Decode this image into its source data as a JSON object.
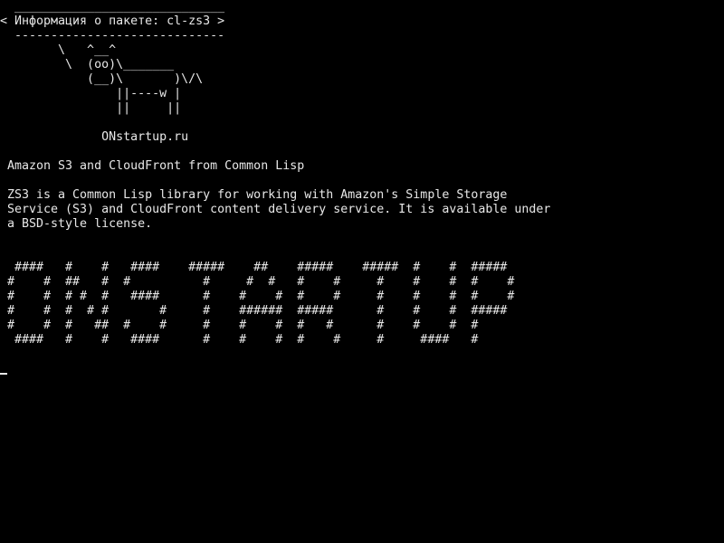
{
  "terminal": {
    "colors": {
      "background": "#000000",
      "foreground": "#e8e8e8"
    },
    "banner": {
      "top_rule": " _____________________________",
      "title": "< Информация о пакете: cl-zs3 >",
      "bottom_rule": " -----------------------------"
    },
    "cow": [
      "       \\   ^__^",
      "        \\  (oo)\\_______",
      "           (__)\\       )\\/\\",
      "               ||----w |",
      "               ||     ||"
    ],
    "site": "             ONstartup.ru",
    "heading": "Amazon S3 and CloudFront from Common Lisp",
    "description": [
      "ZS3 is a Common Lisp library for working with Amazon's Simple Storage",
      "Service (S3) and CloudFront content delivery service. It is available under",
      "a BSD-style license."
    ],
    "figlet": [
      " ####   #    #   ####    #####    ##    #####    #####  #    #  #####",
      "#    #  ##   #  #          #     #  #   #    #     #    #    #  #    #",
      "#    #  # #  #   ####      #    #    #  #    #     #    #    #  #    #",
      "#    #  #  # #       #     #    ######  #####      #    #    #  #####",
      "#    #  #   ##  #    #     #    #    #  #   #      #    #    #  #",
      " ####   #    #   ####      #    #    #  #    #     #     ####   #"
    ],
    "prompt_cursor": "_"
  }
}
